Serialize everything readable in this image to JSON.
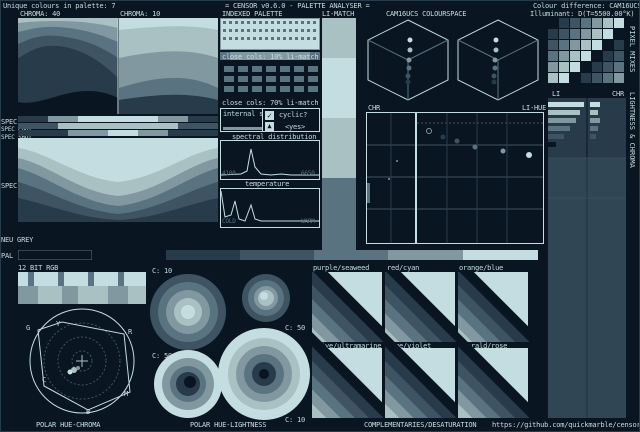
{
  "header": {
    "unique_colours": "Unique colours in palette: 7",
    "title": "= CENSOR v0.6.0 - PALETTE ANALYSER =",
    "colour_difference": "Colour difference: CAM16UCS",
    "illuminant": "Illuminant: D(T=5500.00°K)"
  },
  "palette_colors": [
    "#0a1522",
    "#273b4b",
    "#3e5462",
    "#5a7380",
    "#8198a0",
    "#aac1c4",
    "#c4dde0"
  ],
  "labels": {
    "chroma_40": "CHROMA: 40",
    "chroma_10": "CHROMA: 10",
    "indexed_palette": "INDEXED PALETTE",
    "li_match": "LI-MATCH",
    "colourspace": "CAM16UCS COLOURSPACE",
    "close_cols_10": "close cols: 10% li-match",
    "close_cols_70": "close cols: 70% li-match",
    "internal_similarity": "internal similarity",
    "cyclic": "cyclic?",
    "yes": "<yes>",
    "spectral_distribution": "spectral distribution",
    "temperature": "temperature",
    "wl_low": "4100",
    "wl_high": "6650",
    "cold": "COLD",
    "warm": "WARM",
    "chr": "CHR",
    "li_hue": "LI-HUE",
    "li": "LI",
    "chr2": "CHR",
    "spec": "SPEC",
    "spec_cbdt": "SPEC CBDT",
    "spec_sbdt": "SPEC SBDT",
    "neu_grey": "NEU GREY",
    "pal": "PAL",
    "bit_rgb": "12 BIT RGB",
    "c10": "C: 10",
    "c50": "C: 50",
    "c10b": "C: 10",
    "c50b": "C: 50",
    "c50c": "C: 50",
    "c10c": "C: 10",
    "pairs": [
      "purple/seaweed",
      "red/cyan",
      "orange/blue",
      "olive/ultramarine",
      "lime/violet",
      "emerald/rose"
    ],
    "polar_hue_chroma": "POLAR HUE-CHROMA",
    "polar_hue_lightness": "POLAR HUE-LIGHTNESS",
    "complementaries": "COMPLEMENTARIES/DESATURATION",
    "url": "https://github.com/quickmarble/censor",
    "pixel_mixes": "PIXEL MIXES",
    "lightness_chroma": "LIGHTNESS & CHROMA",
    "polar_letters": [
      "G",
      "Y",
      "R",
      "M",
      "B",
      "C"
    ]
  }
}
